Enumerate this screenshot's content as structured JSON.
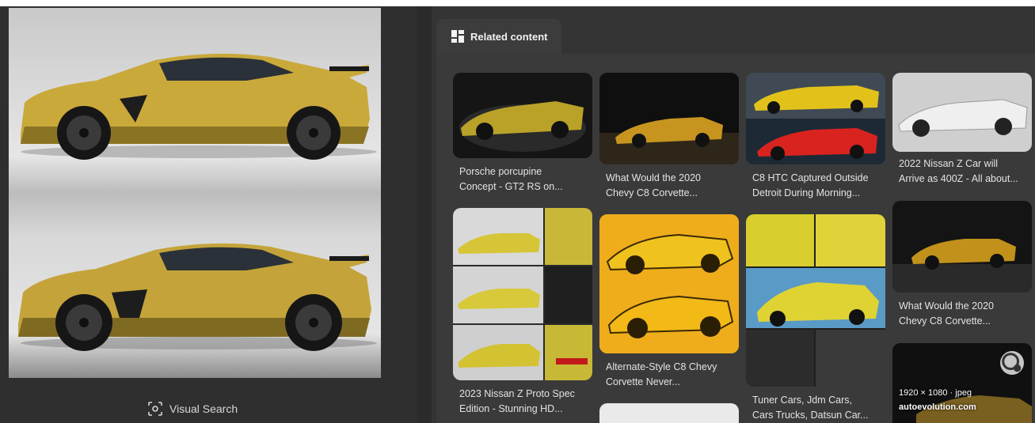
{
  "colors": {
    "background": "#2b2b2b",
    "panel": "#343434",
    "tab": "#3c3c3c",
    "accent_yellow": "#d9b530"
  },
  "left": {
    "visual_search_label": "Visual Search"
  },
  "right": {
    "tab_label": "Related content",
    "cards": [
      {
        "caption_line1": "Porsche porcupine",
        "caption_line2": "Concept - GT2 RS on..."
      },
      {
        "caption_line1": "What Would the 2020",
        "caption_line2": "Chevy C8 Corvette..."
      },
      {
        "caption_line1": "C8 HTC Captured Outside",
        "caption_line2": "Detroit During Morning..."
      },
      {
        "caption_line1": "2022 Nissan Z Car will",
        "caption_line2": "Arrive as 400Z - All about..."
      },
      {
        "caption_line1": "2023 Nissan Z Proto Spec",
        "caption_line2": "Edition - Stunning HD..."
      },
      {
        "caption_line1": "Alternate-Style C8 Chevy",
        "caption_line2": "Corvette Never..."
      },
      {
        "caption_line1": "Tuner Cars, Jdm Cars,",
        "caption_line2": "Cars Trucks, Datsun Car..."
      },
      {
        "caption_line1": "What Would the 2020",
        "caption_line2": "Chevy C8 Corvette..."
      }
    ],
    "hover_card": {
      "size": "1920 × 1080 · jpeg",
      "domain": "autoevolution.com"
    }
  }
}
